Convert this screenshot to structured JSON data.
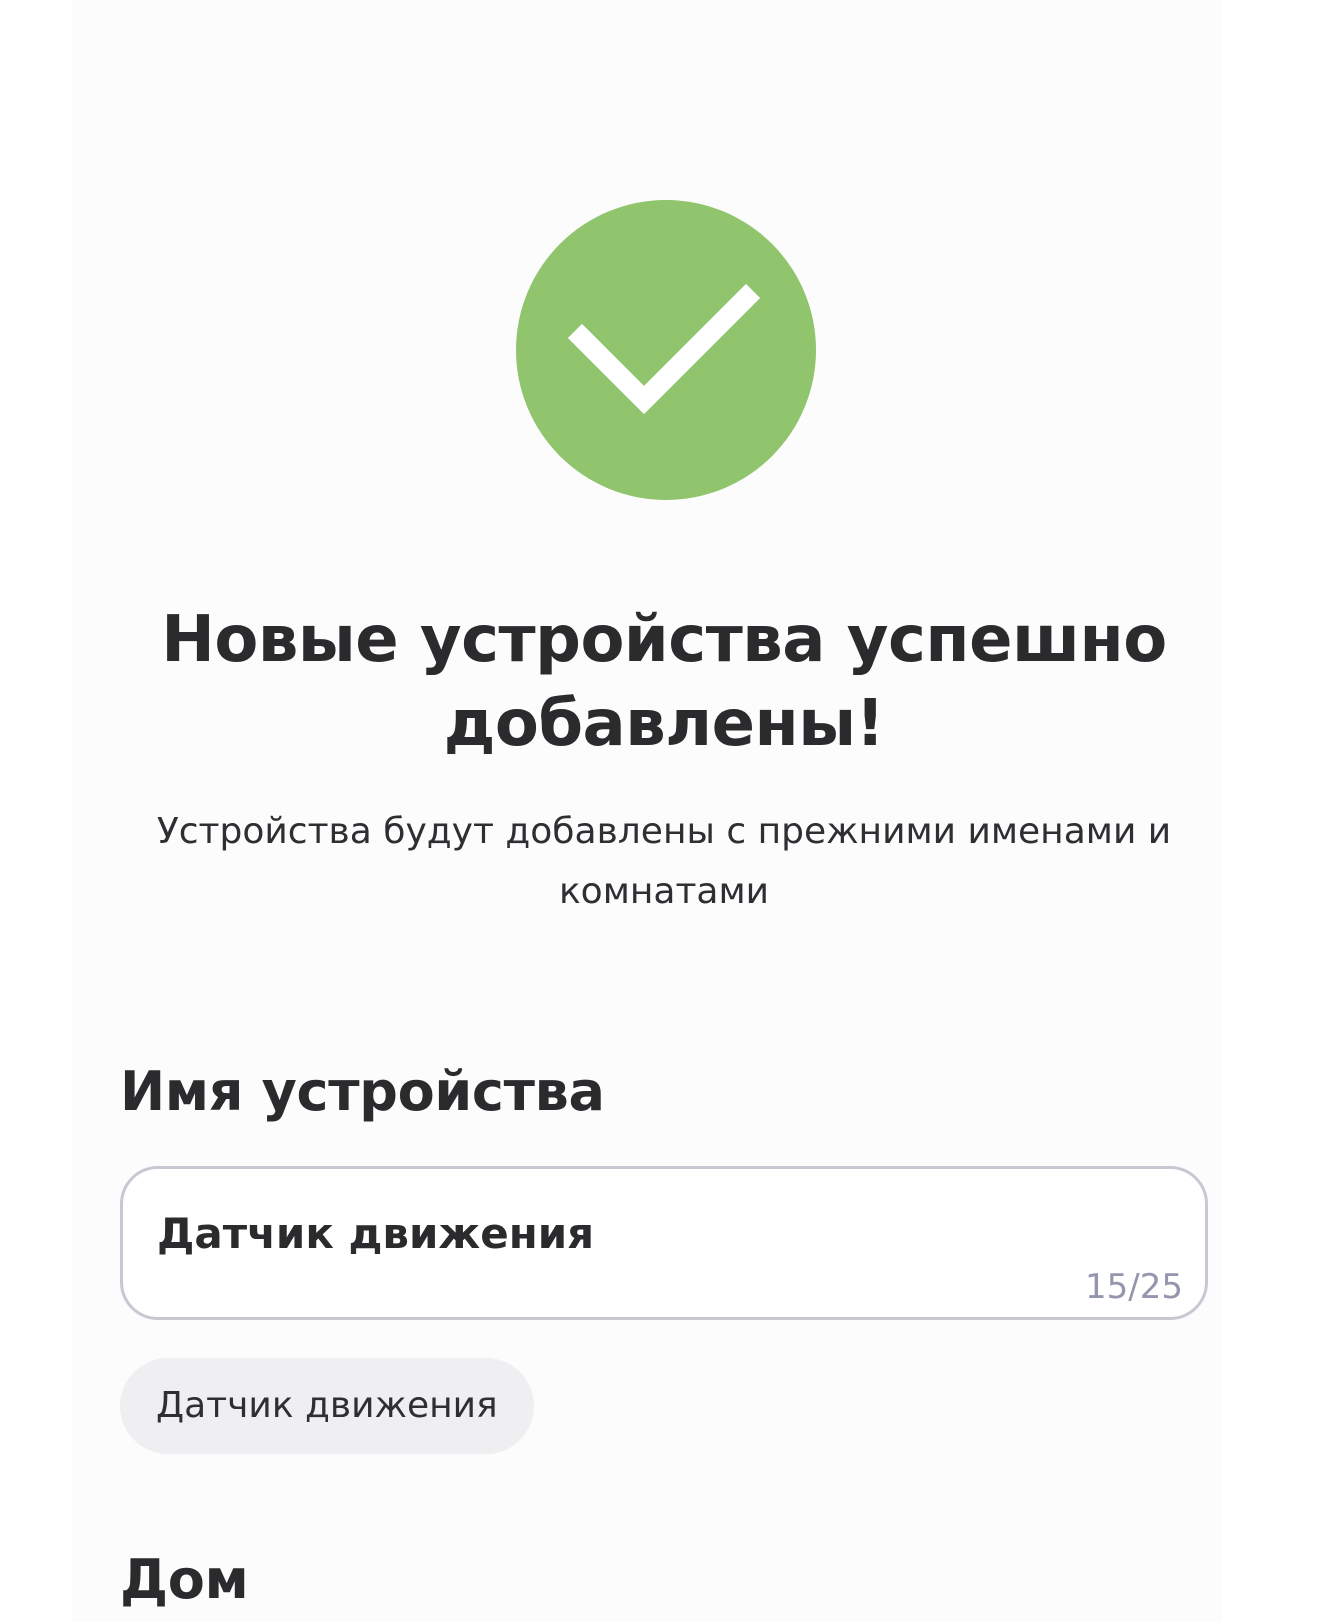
{
  "success": {
    "icon": "check-icon",
    "color": "#90c46d"
  },
  "title": "Новые устройства успешно добавлены!",
  "subtitle": "Устройства будут добавлены с прежними именами и комнатами",
  "device_name": {
    "label": "Имя устройства",
    "value": "Датчик движения",
    "counter": "15/25",
    "suggestion": "Датчик движения"
  },
  "home": {
    "label": "Дом"
  }
}
